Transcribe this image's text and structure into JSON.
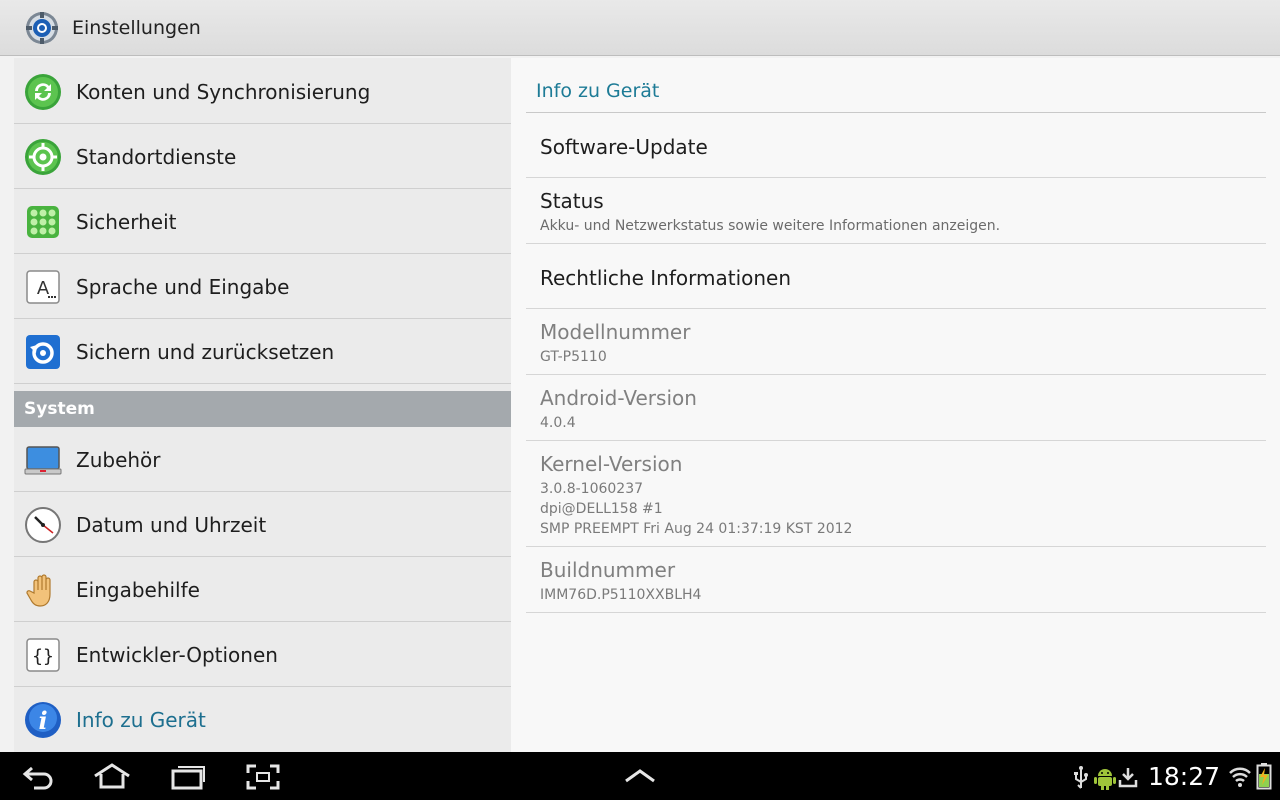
{
  "app": {
    "title": "Einstellungen",
    "icon": "settings-gear-icon"
  },
  "sidebar": {
    "items": [
      {
        "label": "Konten und Synchronisierung",
        "icon": "sync-icon"
      },
      {
        "label": "Standortdienste",
        "icon": "location-icon"
      },
      {
        "label": "Sicherheit",
        "icon": "security-grid-icon"
      },
      {
        "label": "Sprache und Eingabe",
        "icon": "keyboard-a-icon"
      },
      {
        "label": "Sichern und zurücksetzen",
        "icon": "backup-restore-icon"
      }
    ],
    "section_label": "System",
    "system_items": [
      {
        "label": "Zubehör",
        "icon": "accessory-monitor-icon"
      },
      {
        "label": "Datum und Uhrzeit",
        "icon": "clock-icon"
      },
      {
        "label": "Eingabehilfe",
        "icon": "hand-icon"
      },
      {
        "label": "Entwickler-Optionen",
        "icon": "braces-icon"
      },
      {
        "label": "Info zu Gerät",
        "icon": "info-icon",
        "selected": true
      }
    ]
  },
  "detail": {
    "header": "Info zu Gerät",
    "items": [
      {
        "title": "Software-Update"
      },
      {
        "title": "Status",
        "subtitle": "Akku- und Netzwerkstatus sowie weitere Informationen anzeigen."
      },
      {
        "title": "Rechtliche Informationen"
      },
      {
        "title": "Modellnummer",
        "lines": [
          "GT-P5110"
        ]
      },
      {
        "title": "Android-Version",
        "lines": [
          "4.0.4"
        ]
      },
      {
        "title": "Kernel-Version",
        "lines": [
          "3.0.8-1060237",
          "dpi@DELL158 #1",
          "SMP PREEMPT Fri Aug 24 01:37:19 KST 2012"
        ]
      },
      {
        "title": "Buildnummer",
        "lines": [
          "IMM76D.P5110XXBLH4"
        ]
      }
    ]
  },
  "statusbar": {
    "time": "18:27",
    "icons": [
      "usb-icon",
      "android-debug-icon",
      "download-icon",
      "wifi-icon",
      "battery-charging-icon"
    ]
  },
  "nav": {
    "icons": [
      "back-icon",
      "home-icon",
      "recent-apps-icon",
      "screenshot-icon",
      "up-arrow-icon"
    ]
  },
  "colors": {
    "accent": "#1d7b96",
    "section_bg": "#a4a9ad",
    "navbar_bg": "#000000"
  }
}
